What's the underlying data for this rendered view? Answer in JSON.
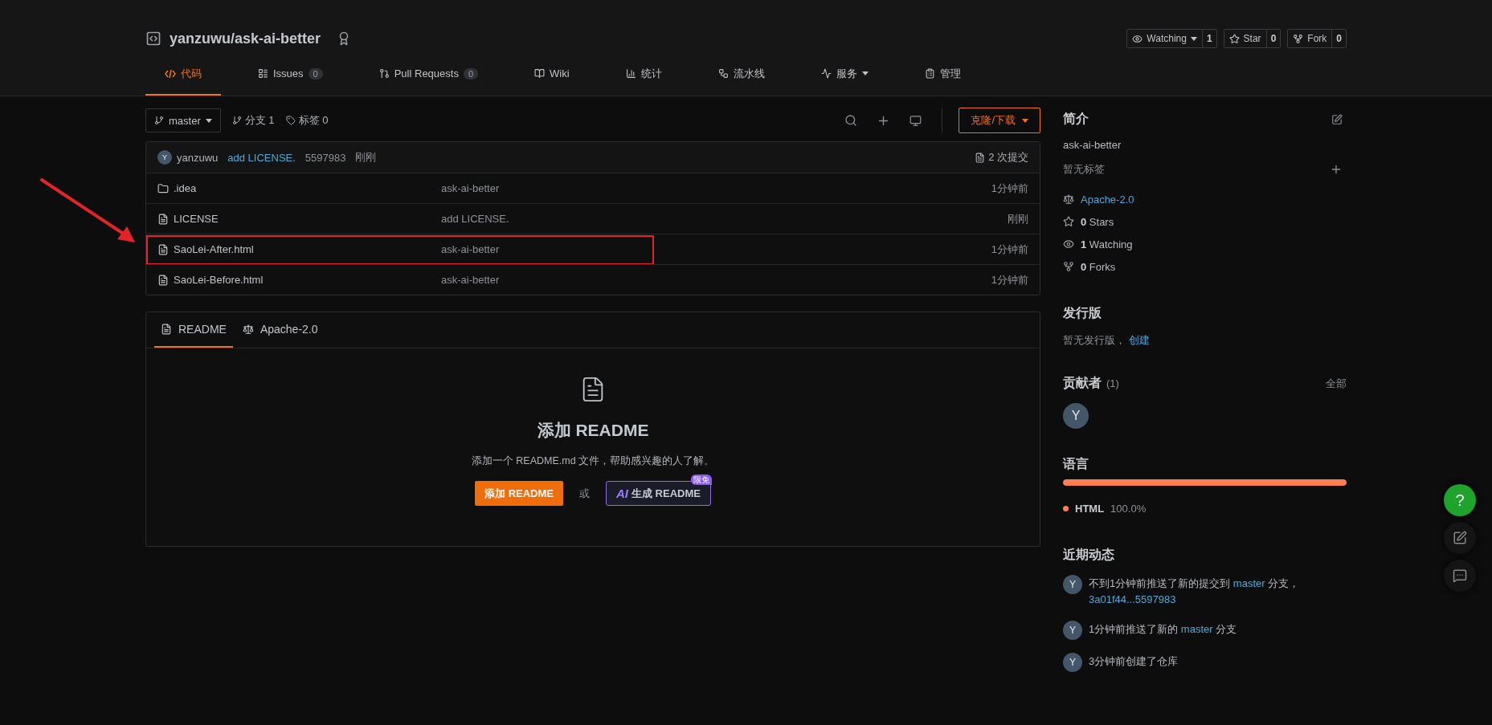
{
  "repo": {
    "name": "yanzuwu/ask-ai-better"
  },
  "actions": [
    {
      "kind": "watch",
      "label": "Watching",
      "count": "1",
      "dropdown": true
    },
    {
      "kind": "star",
      "label": "Star",
      "count": "0",
      "dropdown": false
    },
    {
      "kind": "fork",
      "label": "Fork",
      "count": "0",
      "dropdown": false
    }
  ],
  "tabs": [
    {
      "kind": "code",
      "label": "代码",
      "selected": true
    },
    {
      "kind": "issues",
      "label": "Issues",
      "count": "0",
      "selected": false
    },
    {
      "kind": "pr",
      "label": "Pull Requests",
      "count": "0",
      "selected": false
    },
    {
      "kind": "wiki",
      "label": "Wiki",
      "selected": false
    },
    {
      "kind": "stats",
      "label": "统计",
      "selected": false
    },
    {
      "kind": "pipeline",
      "label": "流水线",
      "selected": false
    },
    {
      "kind": "services",
      "label": "服务",
      "dropdown": true,
      "selected": false
    },
    {
      "kind": "manage",
      "label": "管理",
      "selected": false
    }
  ],
  "toolbar": {
    "branch": "master",
    "branches": "分支 1",
    "tags": "标签 0",
    "clone_button": "克隆/下载"
  },
  "last_commit": {
    "avatar": "Y",
    "author": "yanzuwu",
    "message": "add LICENSE.",
    "hash": "5597983",
    "time": "刚刚",
    "commits": "2 次提交"
  },
  "files": [
    {
      "kind": "folder",
      "name": ".idea",
      "message": "ask-ai-better",
      "time": "1分钟前",
      "highlighted": false
    },
    {
      "kind": "file",
      "name": "LICENSE",
      "message": "add LICENSE.",
      "time": "刚刚",
      "highlighted": false
    },
    {
      "kind": "file",
      "name": "SaoLei-After.html",
      "message": "ask-ai-better",
      "time": "1分钟前",
      "highlighted": true
    },
    {
      "kind": "file",
      "name": "SaoLei-Before.html",
      "message": "ask-ai-better",
      "time": "1分钟前",
      "highlighted": false
    }
  ],
  "readme_tabs": [
    {
      "kind": "readme",
      "label": "README",
      "selected": true
    },
    {
      "kind": "license",
      "label": "Apache-2.0",
      "selected": false
    }
  ],
  "readme_empty": {
    "title": "添加 README",
    "description": "添加一个 README.md 文件，帮助感兴趣的人了解。",
    "add_button": "添加 README",
    "or": "或",
    "ai_mark": "AI",
    "ai_button": "生成 README",
    "ai_badge": "限免"
  },
  "sidebar": {
    "about": {
      "title": "简介",
      "description": "ask-ai-better",
      "no_tags": "暂无标签",
      "license": "Apache-2.0",
      "stats": [
        {
          "kind": "star",
          "count": "0",
          "label": "Stars"
        },
        {
          "kind": "watch",
          "count": "1",
          "label": "Watching"
        },
        {
          "kind": "fork",
          "count": "0",
          "label": "Forks"
        }
      ]
    },
    "releases": {
      "title": "发行版",
      "empty": "暂无发行版，",
      "create_link": "创建"
    },
    "contributors": {
      "title": "贡献者",
      "count": "(1)",
      "all_link": "全部",
      "avatars": [
        "Y"
      ]
    },
    "languages": {
      "title": "语言",
      "items": [
        {
          "name": "HTML",
          "percent": "100.0%",
          "level": 1,
          "color": "#ff7f50"
        }
      ]
    },
    "activity": {
      "title": "近期动态",
      "items": [
        {
          "avatar": "Y",
          "parts": [
            {
              "text": "不到1分钟前推送了新的提交到 ",
              "link": false
            },
            {
              "text": "master",
              "link": true
            },
            {
              "text": " 分支，",
              "link": false
            },
            {
              "text": "3a01f44...5597983",
              "link": true
            }
          ]
        },
        {
          "avatar": "Y",
          "parts": [
            {
              "text": "1分钟前推送了新的 ",
              "link": false
            },
            {
              "text": "master",
              "link": true
            },
            {
              "text": " 分支",
              "link": false
            }
          ]
        },
        {
          "avatar": "Y",
          "parts": [
            {
              "text": "3分钟前创建了仓库",
              "link": false
            }
          ]
        }
      ]
    }
  },
  "float_buttons": {
    "help": "?"
  }
}
